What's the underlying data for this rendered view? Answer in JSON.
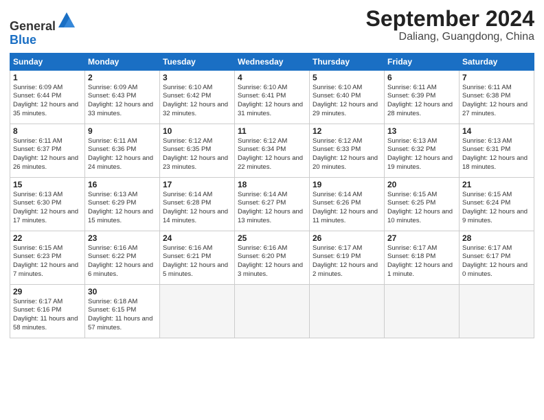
{
  "header": {
    "logo_line1": "General",
    "logo_line2": "Blue",
    "month": "September 2024",
    "location": "Daliang, Guangdong, China"
  },
  "weekdays": [
    "Sunday",
    "Monday",
    "Tuesday",
    "Wednesday",
    "Thursday",
    "Friday",
    "Saturday"
  ],
  "weeks": [
    [
      {
        "day": "1",
        "sunrise": "6:09 AM",
        "sunset": "6:44 PM",
        "daylight": "12 hours and 35 minutes."
      },
      {
        "day": "2",
        "sunrise": "6:09 AM",
        "sunset": "6:43 PM",
        "daylight": "12 hours and 33 minutes."
      },
      {
        "day": "3",
        "sunrise": "6:10 AM",
        "sunset": "6:42 PM",
        "daylight": "12 hours and 32 minutes."
      },
      {
        "day": "4",
        "sunrise": "6:10 AM",
        "sunset": "6:41 PM",
        "daylight": "12 hours and 31 minutes."
      },
      {
        "day": "5",
        "sunrise": "6:10 AM",
        "sunset": "6:40 PM",
        "daylight": "12 hours and 29 minutes."
      },
      {
        "day": "6",
        "sunrise": "6:11 AM",
        "sunset": "6:39 PM",
        "daylight": "12 hours and 28 minutes."
      },
      {
        "day": "7",
        "sunrise": "6:11 AM",
        "sunset": "6:38 PM",
        "daylight": "12 hours and 27 minutes."
      }
    ],
    [
      {
        "day": "8",
        "sunrise": "6:11 AM",
        "sunset": "6:37 PM",
        "daylight": "12 hours and 26 minutes."
      },
      {
        "day": "9",
        "sunrise": "6:11 AM",
        "sunset": "6:36 PM",
        "daylight": "12 hours and 24 minutes."
      },
      {
        "day": "10",
        "sunrise": "6:12 AM",
        "sunset": "6:35 PM",
        "daylight": "12 hours and 23 minutes."
      },
      {
        "day": "11",
        "sunrise": "6:12 AM",
        "sunset": "6:34 PM",
        "daylight": "12 hours and 22 minutes."
      },
      {
        "day": "12",
        "sunrise": "6:12 AM",
        "sunset": "6:33 PM",
        "daylight": "12 hours and 20 minutes."
      },
      {
        "day": "13",
        "sunrise": "6:13 AM",
        "sunset": "6:32 PM",
        "daylight": "12 hours and 19 minutes."
      },
      {
        "day": "14",
        "sunrise": "6:13 AM",
        "sunset": "6:31 PM",
        "daylight": "12 hours and 18 minutes."
      }
    ],
    [
      {
        "day": "15",
        "sunrise": "6:13 AM",
        "sunset": "6:30 PM",
        "daylight": "12 hours and 17 minutes."
      },
      {
        "day": "16",
        "sunrise": "6:13 AM",
        "sunset": "6:29 PM",
        "daylight": "12 hours and 15 minutes."
      },
      {
        "day": "17",
        "sunrise": "6:14 AM",
        "sunset": "6:28 PM",
        "daylight": "12 hours and 14 minutes."
      },
      {
        "day": "18",
        "sunrise": "6:14 AM",
        "sunset": "6:27 PM",
        "daylight": "12 hours and 13 minutes."
      },
      {
        "day": "19",
        "sunrise": "6:14 AM",
        "sunset": "6:26 PM",
        "daylight": "12 hours and 11 minutes."
      },
      {
        "day": "20",
        "sunrise": "6:15 AM",
        "sunset": "6:25 PM",
        "daylight": "12 hours and 10 minutes."
      },
      {
        "day": "21",
        "sunrise": "6:15 AM",
        "sunset": "6:24 PM",
        "daylight": "12 hours and 9 minutes."
      }
    ],
    [
      {
        "day": "22",
        "sunrise": "6:15 AM",
        "sunset": "6:23 PM",
        "daylight": "12 hours and 7 minutes."
      },
      {
        "day": "23",
        "sunrise": "6:16 AM",
        "sunset": "6:22 PM",
        "daylight": "12 hours and 6 minutes."
      },
      {
        "day": "24",
        "sunrise": "6:16 AM",
        "sunset": "6:21 PM",
        "daylight": "12 hours and 5 minutes."
      },
      {
        "day": "25",
        "sunrise": "6:16 AM",
        "sunset": "6:20 PM",
        "daylight": "12 hours and 3 minutes."
      },
      {
        "day": "26",
        "sunrise": "6:17 AM",
        "sunset": "6:19 PM",
        "daylight": "12 hours and 2 minutes."
      },
      {
        "day": "27",
        "sunrise": "6:17 AM",
        "sunset": "6:18 PM",
        "daylight": "12 hours and 1 minute."
      },
      {
        "day": "28",
        "sunrise": "6:17 AM",
        "sunset": "6:17 PM",
        "daylight": "12 hours and 0 minutes."
      }
    ],
    [
      {
        "day": "29",
        "sunrise": "6:17 AM",
        "sunset": "6:16 PM",
        "daylight": "11 hours and 58 minutes."
      },
      {
        "day": "30",
        "sunrise": "6:18 AM",
        "sunset": "6:15 PM",
        "daylight": "11 hours and 57 minutes."
      },
      null,
      null,
      null,
      null,
      null
    ]
  ]
}
